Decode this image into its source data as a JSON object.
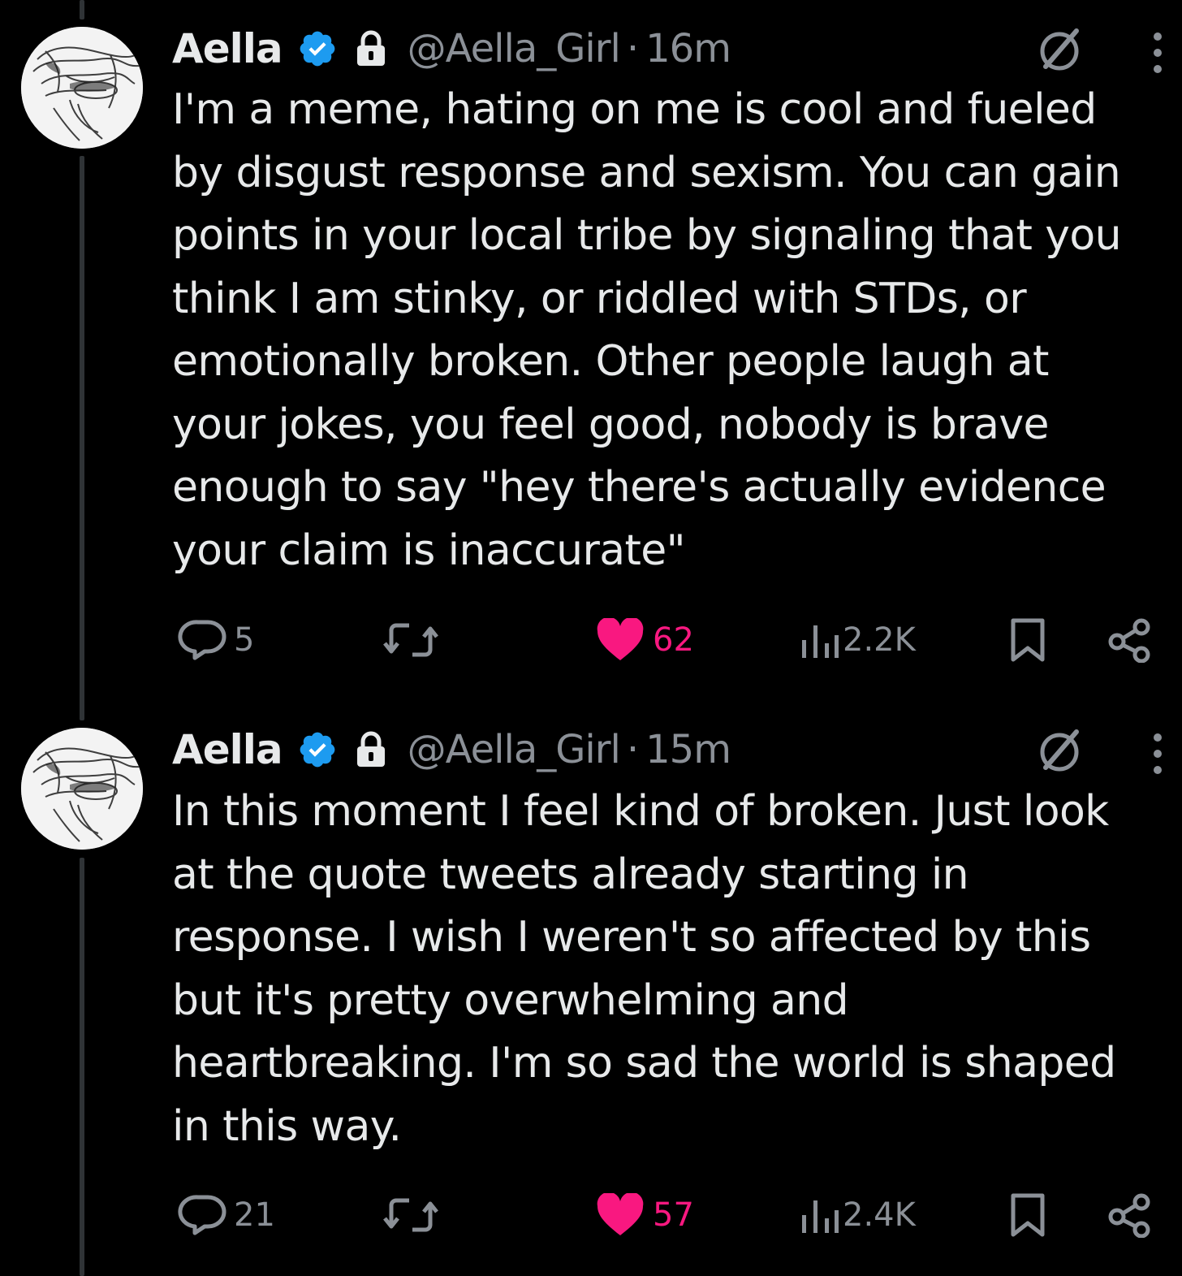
{
  "tweets": [
    {
      "author": {
        "name": "Aella",
        "handle": "@Aella_Girl",
        "verified": true,
        "protected": true
      },
      "separator": "·",
      "time": "16m",
      "text": "I'm a meme, hating on me is cool and fueled\nby disgust response and sexism. You can gain\npoints in your local tribe by signaling that you\nthink I am stinky, or riddled with STDs, or\nemotionally broken. Other people laugh at\nyour jokes, you feel good, nobody is brave\nenough to say \"hey there's actually evidence\nyour claim is inaccurate\"",
      "stats": {
        "replies": "5",
        "reposts": "",
        "likes": "62",
        "views": "2.2K"
      },
      "liked": true
    },
    {
      "author": {
        "name": "Aella",
        "handle": "@Aella_Girl",
        "verified": true,
        "protected": true
      },
      "separator": "·",
      "time": "15m",
      "text": "In this moment I feel kind of broken. Just look\nat the quote tweets already starting in\nresponse. I wish I weren't so affected by this\nbut it's pretty overwhelming and\nheartbreaking. I'm so sad the world is shaped\nin this way.",
      "stats": {
        "replies": "21",
        "reposts": "",
        "likes": "57",
        "views": "2.4K"
      },
      "liked": true
    }
  ],
  "icons": {
    "reply": "reply-icon",
    "repost": "repost-icon",
    "like": "heart-icon",
    "views": "views-icon",
    "bookmark": "bookmark-icon",
    "share": "share-icon",
    "grok": "grok-icon",
    "more": "more-vertical-icon",
    "verified": "verified-badge-icon",
    "lock": "lock-icon"
  },
  "colors": {
    "background": "#000000",
    "text": "#e7e9ea",
    "secondary": "#8b9097",
    "like": "#f91880",
    "verified": "#1d9bf0"
  }
}
